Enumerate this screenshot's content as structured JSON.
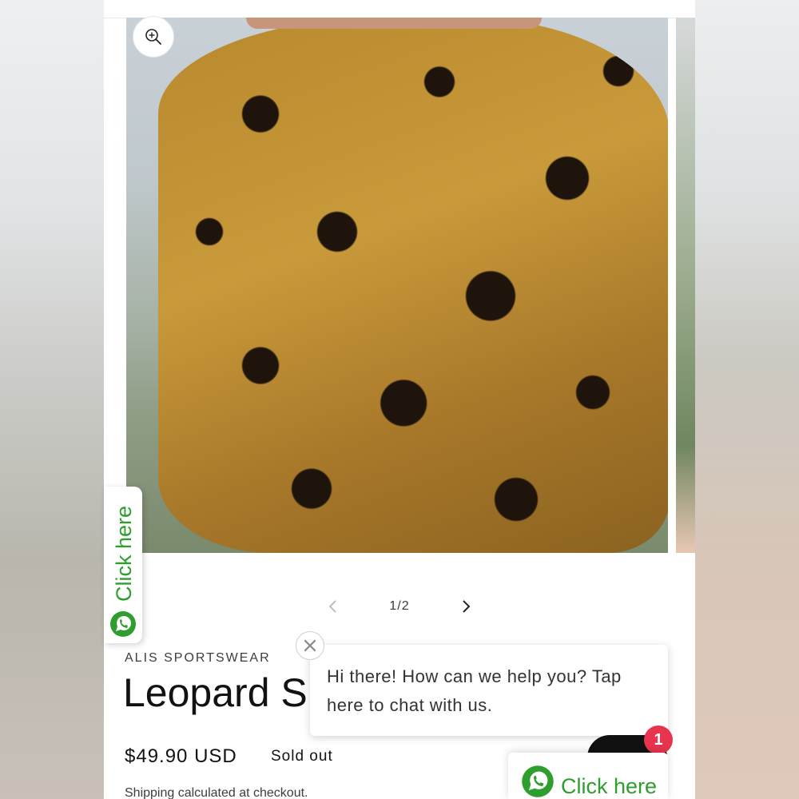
{
  "gallery": {
    "counter": "1/2",
    "zoom_icon": "zoom-in-icon",
    "prev_icon": "chevron-left-icon",
    "next_icon": "chevron-right-icon"
  },
  "product": {
    "vendor": "ALIS SPORTSWEAR",
    "title": "Leopard Sh",
    "price": "$49.90 USD",
    "availability": "Sold out",
    "shipping_note": "Shipping calculated at checkout."
  },
  "whatsapp": {
    "side_tab_label": "Click here",
    "bottom_button_label": "Click here",
    "chat_message": "Hi there! How can we help you? Tap here to chat with us.",
    "notification_count": "1",
    "brand_color": "#2e9e2e",
    "badge_color": "#e8344e"
  }
}
